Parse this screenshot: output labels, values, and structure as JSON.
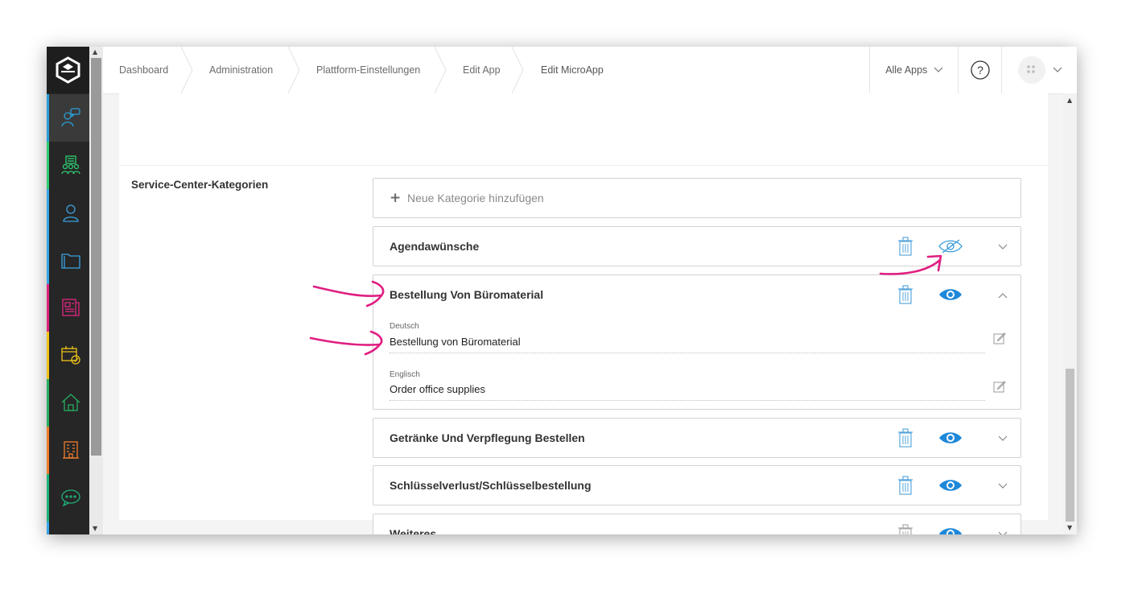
{
  "breadcrumb": [
    {
      "label": "Dashboard"
    },
    {
      "label": "Administration"
    },
    {
      "label": "Plattform-Einstellungen"
    },
    {
      "label": "Edit App"
    },
    {
      "label": "Edit MicroApp"
    }
  ],
  "header": {
    "apps_label": "Alle Apps",
    "help_symbol": "?"
  },
  "sidebar": {
    "items": [
      {
        "name": "support-icon",
        "color": "#2a9fd8",
        "active": true
      },
      {
        "name": "group-icon",
        "color": "#2ecc71"
      },
      {
        "name": "person-icon",
        "color": "#3aa3e3"
      },
      {
        "name": "folder-icon",
        "color": "#3aa3e3"
      },
      {
        "name": "newspaper-icon",
        "color": "#e0267f"
      },
      {
        "name": "calendar-check-icon",
        "color": "#f0c419"
      },
      {
        "name": "home-icon",
        "color": "#27ae60"
      },
      {
        "name": "building-icon",
        "color": "#f07d2c"
      },
      {
        "name": "chat-icon",
        "color": "#1fb37a"
      }
    ]
  },
  "section": {
    "label": "Service-Center-Kategorien",
    "add_label": "Neue Kategorie hinzufügen"
  },
  "categories": [
    {
      "title": "Agendawünsche",
      "visible": false,
      "expanded": false
    },
    {
      "title": "Bestellung Von Büromaterial",
      "visible": true,
      "expanded": true,
      "fields": [
        {
          "label": "Deutsch",
          "value": "Bestellung von Büromaterial"
        },
        {
          "label": "Englisch",
          "value": "Order office supplies"
        }
      ]
    },
    {
      "title": "Getränke Und Verpflegung Bestellen",
      "visible": true,
      "expanded": false
    },
    {
      "title": "Schlüsselverlust/Schlüsselbestellung",
      "visible": true,
      "expanded": false
    },
    {
      "title": "Weiteres",
      "visible": true,
      "expanded": false
    }
  ],
  "colors": {
    "accent_blue": "#1e88d9",
    "annotation_pink": "#e01f82",
    "sidebar_bg": "#262626"
  }
}
